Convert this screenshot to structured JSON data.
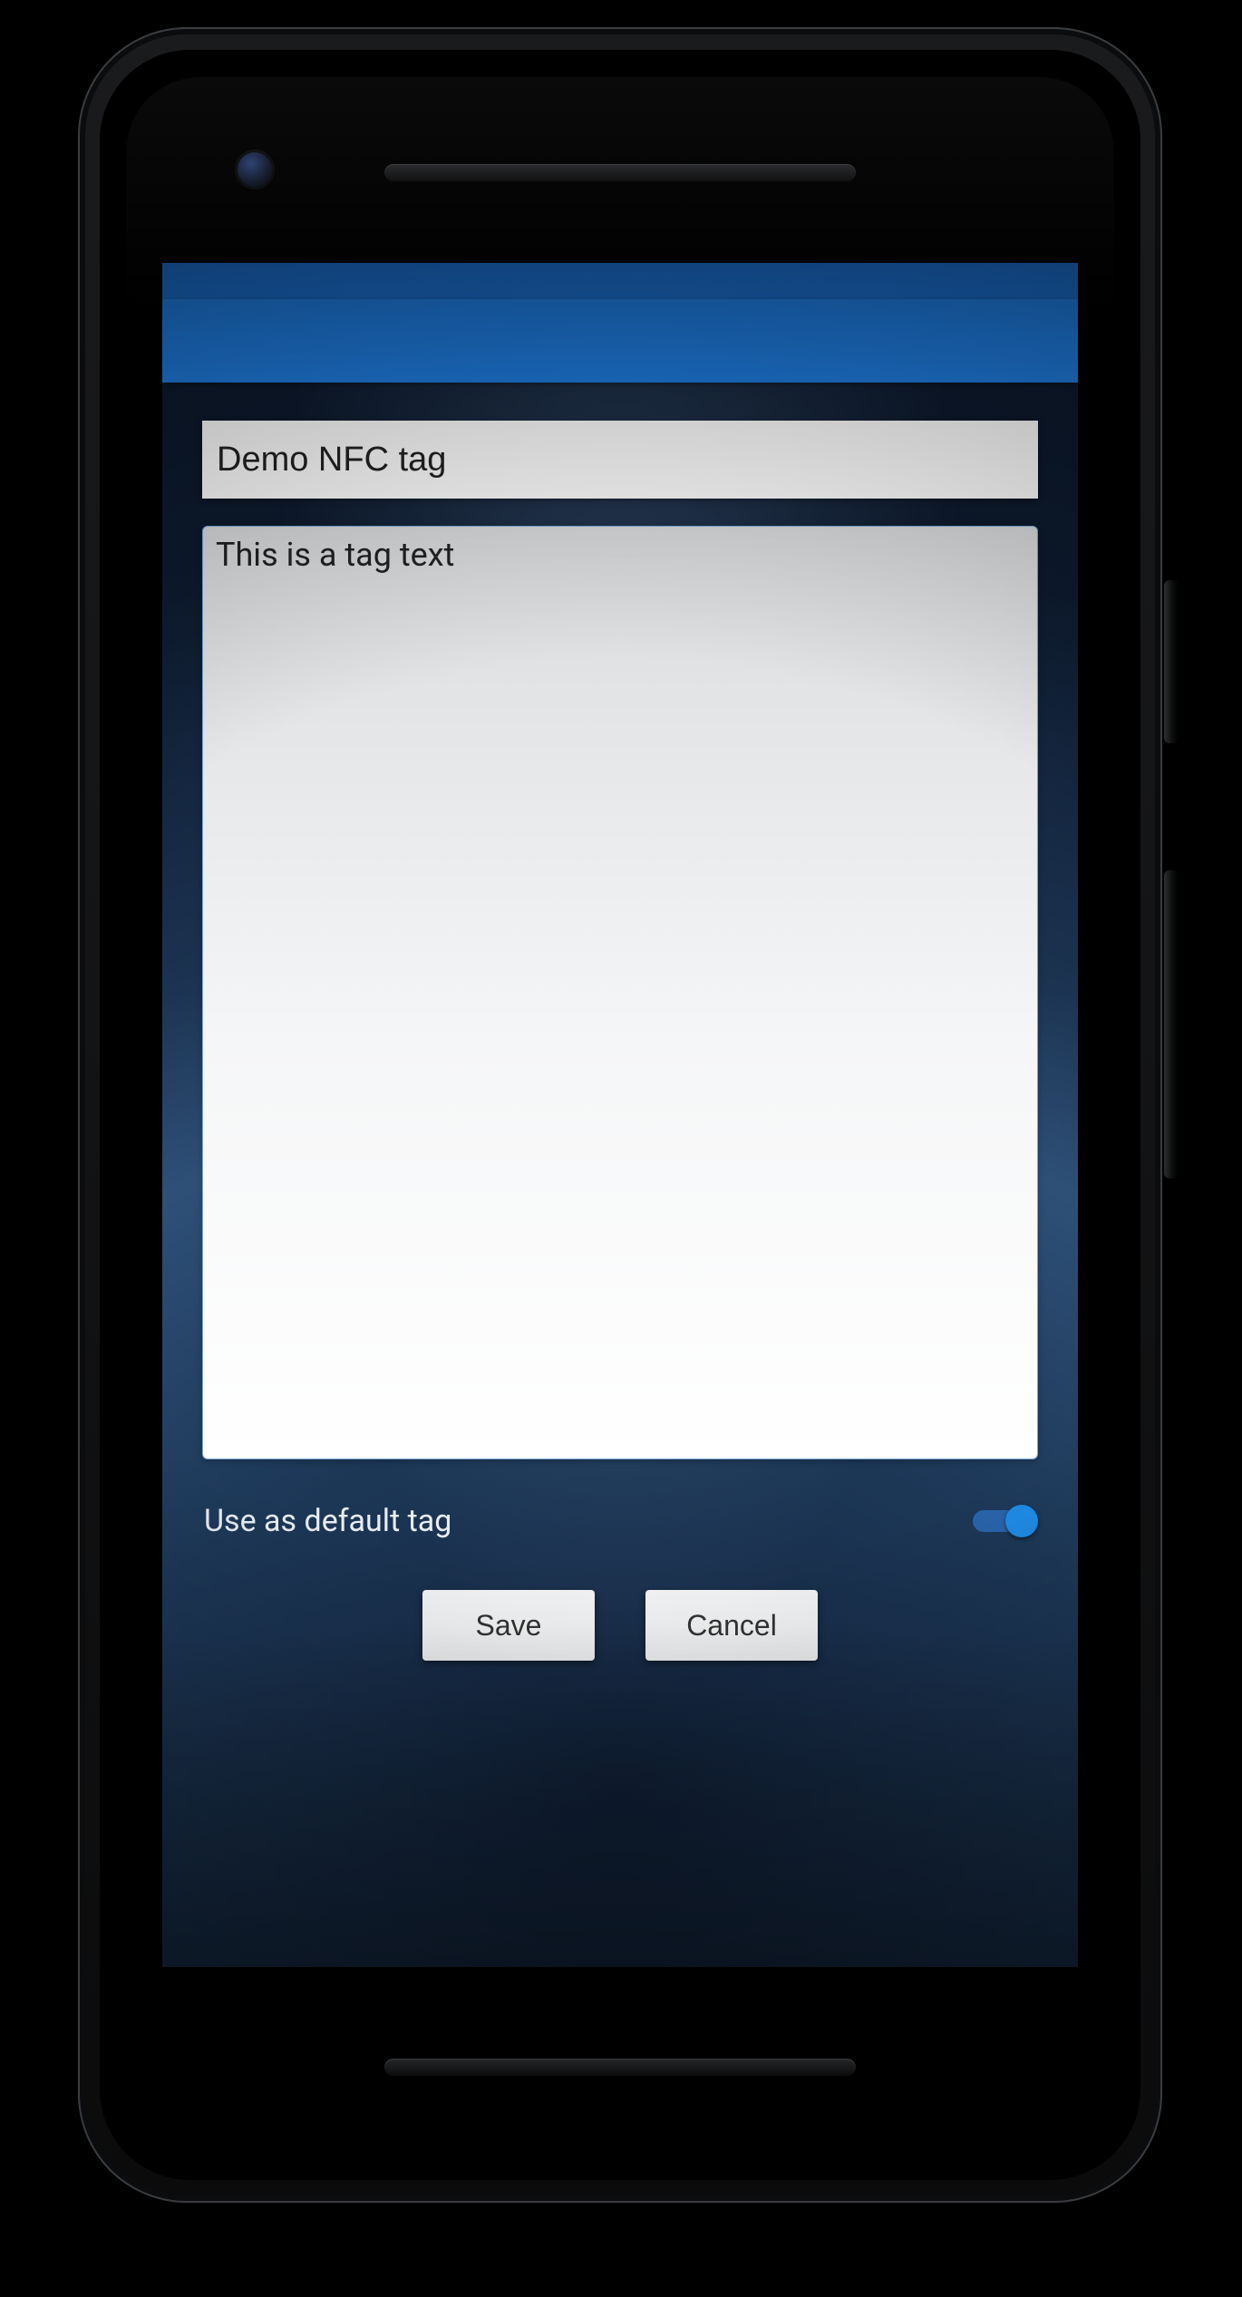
{
  "colors": {
    "status_bar": "#1a6fd1",
    "app_bar": "#1f7fe5",
    "switch_thumb": "#1f8be6"
  },
  "form": {
    "title_value": "Demo NFC tag",
    "body_value": "This is a tag text",
    "default_label": "Use as default tag",
    "default_checked": true
  },
  "buttons": {
    "save": "Save",
    "cancel": "Cancel"
  }
}
